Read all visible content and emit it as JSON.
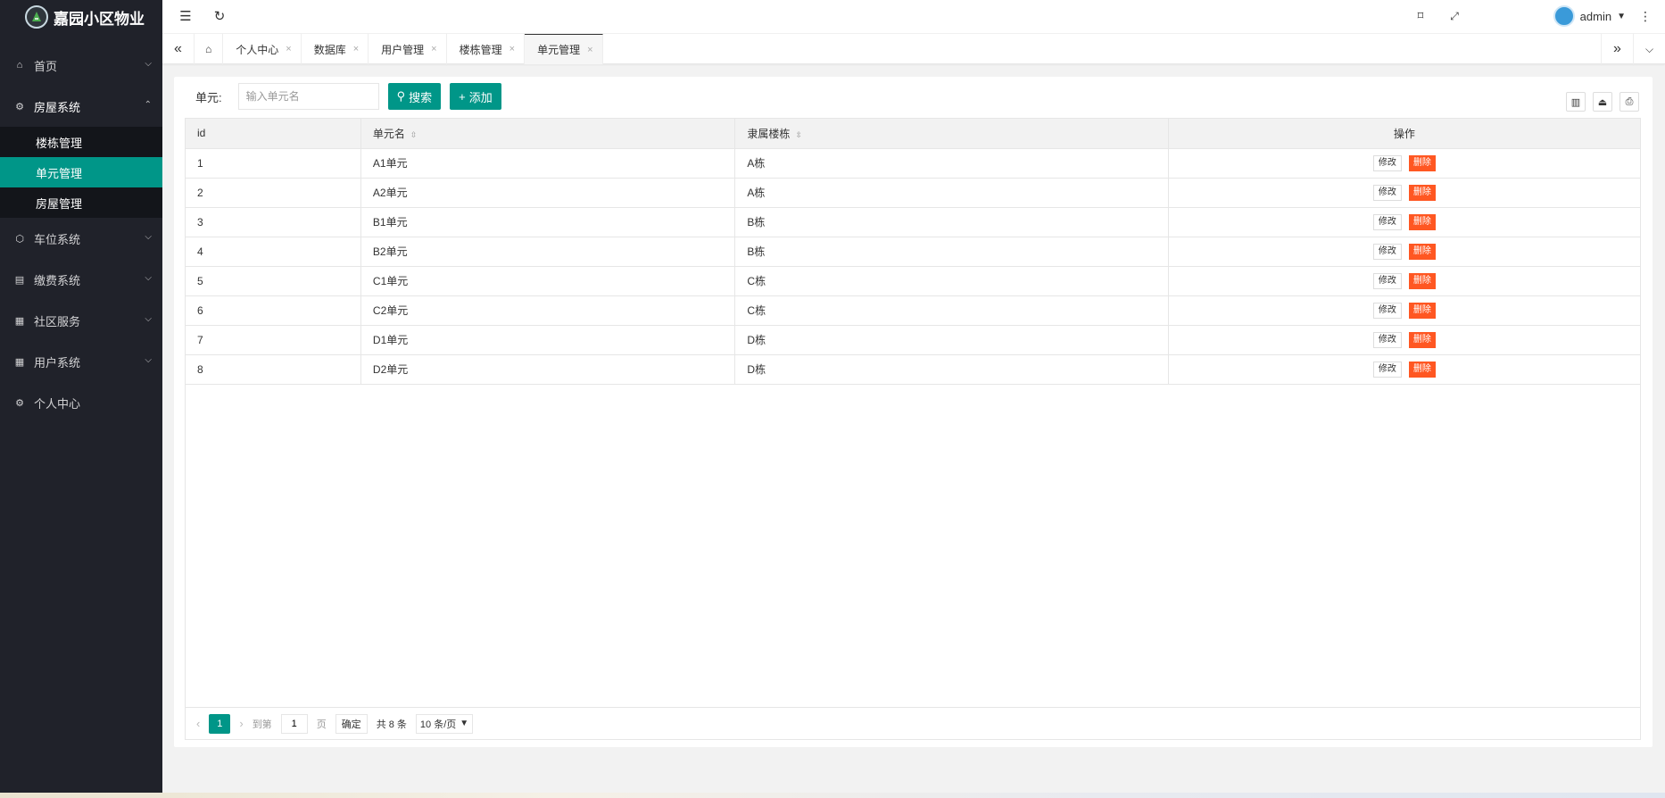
{
  "app": {
    "title": "嘉园小区物业"
  },
  "sidebar": {
    "items": [
      {
        "label": "首页",
        "icon": "home-icon"
      },
      {
        "label": "房屋系统",
        "icon": "gear-icon"
      },
      {
        "label": "车位系统",
        "icon": "cube-icon"
      },
      {
        "label": "缴费系统",
        "icon": "list-icon"
      },
      {
        "label": "社区服务",
        "icon": "app-icon"
      },
      {
        "label": "用户系统",
        "icon": "app-icon"
      },
      {
        "label": "个人中心",
        "icon": "gear-icon"
      }
    ],
    "submenu": [
      {
        "label": "楼栋管理"
      },
      {
        "label": "单元管理"
      },
      {
        "label": "房屋管理"
      }
    ]
  },
  "header": {
    "user": "admin"
  },
  "tabs": [
    {
      "label": "个人中心"
    },
    {
      "label": "数据库"
    },
    {
      "label": "用户管理"
    },
    {
      "label": "楼栋管理"
    },
    {
      "label": "单元管理"
    }
  ],
  "search": {
    "label": "单元:",
    "placeholder": "输入单元名",
    "search_btn": "搜索",
    "add_btn": "添加"
  },
  "table": {
    "columns": [
      "id",
      "单元名",
      "隶属楼栋",
      "操作"
    ],
    "rows": [
      {
        "id": "1",
        "name": "A1单元",
        "building": "A栋"
      },
      {
        "id": "2",
        "name": "A2单元",
        "building": "A栋"
      },
      {
        "id": "3",
        "name": "B1单元",
        "building": "B栋"
      },
      {
        "id": "4",
        "name": "B2单元",
        "building": "B栋"
      },
      {
        "id": "5",
        "name": "C1单元",
        "building": "C栋"
      },
      {
        "id": "6",
        "name": "C2单元",
        "building": "C栋"
      },
      {
        "id": "7",
        "name": "D1单元",
        "building": "D栋"
      },
      {
        "id": "8",
        "name": "D2单元",
        "building": "D栋"
      }
    ],
    "edit_label": "修改",
    "delete_label": "删除"
  },
  "pager": {
    "current": "1",
    "goto_label": "到第",
    "page_value": "1",
    "page_suffix": "页",
    "confirm": "确定",
    "total": "共 8 条",
    "page_size": "10 条/页"
  },
  "colors": {
    "accent": "#009688",
    "danger": "#ff5722",
    "sidebar": "#20222a"
  }
}
